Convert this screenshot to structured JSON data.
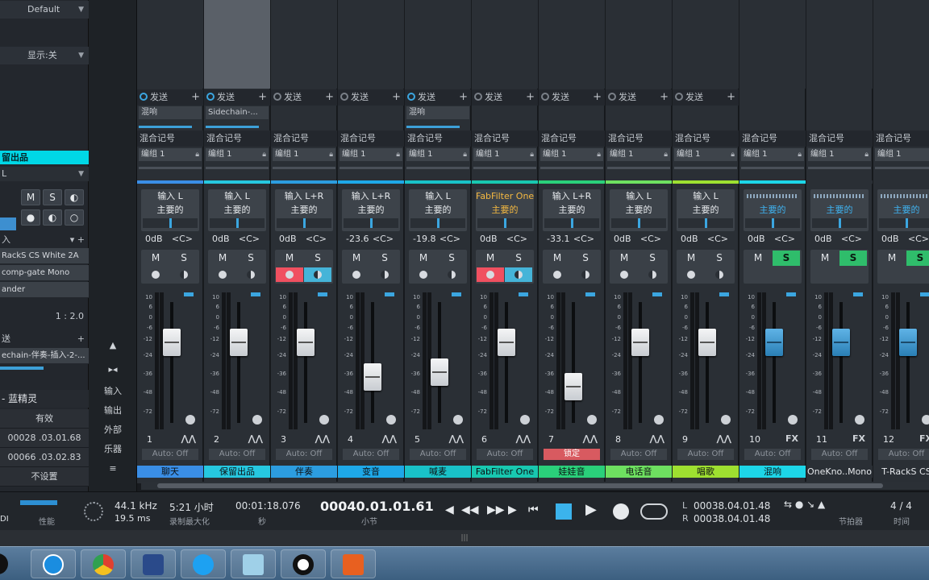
{
  "left": {
    "preset": "Default",
    "display": "显示:关",
    "track_title": "留出品",
    "track_input": "L",
    "plugins": [
      "RackS CS White 2A",
      "comp-gate Mono",
      "ander"
    ],
    "insert_label": "入",
    "ratio": "1 : 2.0",
    "send_label": "送",
    "sidechain": "echain-伴奏-插入-2-...",
    "instrument_name": "- 蓝精灵",
    "effective": "有效",
    "time1": "00028 .03.01.68",
    "time2": "00066 .03.02.83",
    "not_set": "不设置",
    "m": "M",
    "s": "S"
  },
  "nav": {
    "input": "输入",
    "output": "输出",
    "external": "外部",
    "instrument": "乐器"
  },
  "common": {
    "send": "发送",
    "mixlabel": "混合记号",
    "group": "编组 1",
    "m": "M",
    "s": "S",
    "auto": "Auto: Off",
    "scale": [
      "10",
      "6",
      "0",
      "-6",
      "-12",
      "-24",
      "-36",
      "-48",
      "-72"
    ]
  },
  "strips": [
    {
      "io1": "输入 L",
      "io2": "主要的",
      "vol": "0dB",
      "pan": "<C>",
      "num": "1",
      "name": "聊天",
      "send_slot": "混响",
      "color": "#3a8ee6",
      "fader": 0.33
    },
    {
      "io1": "输入 L",
      "io2": "主要的",
      "vol": "0dB",
      "pan": "<C>",
      "num": "2",
      "name": "保留出品",
      "send_slot": "Sidechain-...",
      "color": "#26c8e0",
      "fader": 0.33
    },
    {
      "io1": "输入 L+R",
      "io2": "主要的",
      "vol": "0dB",
      "pan": "<C>",
      "num": "3",
      "name": "伴奏",
      "send_slot": "",
      "color": "#2c9de0",
      "fader": 0.33
    },
    {
      "io1": "输入 L+R",
      "io2": "主要的",
      "vol": "-23.6",
      "pan": "<C>",
      "num": "4",
      "name": "变音",
      "send_slot": "",
      "color": "#1ea8e8",
      "fader": 0.62
    },
    {
      "io1": "输入 L",
      "io2": "主要的",
      "vol": "-19.8",
      "pan": "<C>",
      "num": "5",
      "name": "喊麦",
      "send_slot": "混响",
      "color": "#19c2c8",
      "fader": 0.58
    },
    {
      "io1": "FabFilter One",
      "io2": "主要的",
      "vol": "0dB",
      "pan": "<C>",
      "num": "6",
      "name": "FabFilter One",
      "send_slot": "",
      "color": "#18c8b0",
      "fader": 0.33
    },
    {
      "io1": "输入 L+R",
      "io2": "主要的",
      "vol": "-33.1",
      "pan": "<C>",
      "num": "7",
      "name": "娃娃音",
      "send_slot": "",
      "color": "#2ad07a",
      "fader": 0.7,
      "locked": "锁定"
    },
    {
      "io1": "输入 L",
      "io2": "主要的",
      "vol": "0dB",
      "pan": "<C>",
      "num": "8",
      "name": "电话音",
      "send_slot": "",
      "color": "#6ee060",
      "fader": 0.33
    },
    {
      "io1": "输入 L",
      "io2": "主要的",
      "vol": "0dB",
      "pan": "<C>",
      "num": "9",
      "name": "唱歌",
      "send_slot": "",
      "color": "#9ee030",
      "fader": 0.33
    },
    {
      "io1": "",
      "io2": "主要的",
      "vol": "0dB",
      "pan": "<C>",
      "num": "10",
      "name": "混响",
      "send_slot": "",
      "color": "#1dd6e8",
      "fader": 0.33,
      "fx": "FX"
    },
    {
      "io1": "",
      "io2": "主要的",
      "vol": "0dB",
      "pan": "<C>",
      "num": "11",
      "name": "OneKno..Mono",
      "send_slot": "",
      "color": "#2a2f35",
      "fader": 0.33,
      "fx": "FX"
    },
    {
      "io1": "",
      "io2": "主要的",
      "vol": "0dB",
      "pan": "<C>",
      "num": "12",
      "name": "T-RackS CS",
      "send_slot": "",
      "color": "#2a2f35",
      "fader": 0.33,
      "fx": "FX"
    }
  ],
  "transport": {
    "midi": "DI",
    "perf": "性能",
    "rate": "44.1 kHz",
    "latency": "19.5 ms",
    "rec_time": "5:21 小时",
    "rec_max": "录制最大化",
    "seconds": "00:01:18.076",
    "seconds_unit": "秒",
    "bars": "00040.01.01.61",
    "bars_unit": "小节",
    "loop_l_label": "L",
    "loop_l": "00038.04.01.48",
    "loop_r_label": "R",
    "loop_r": "00038.04.01.48",
    "metronome": "节拍器",
    "sig": "4 / 4",
    "time_label": "时间"
  }
}
